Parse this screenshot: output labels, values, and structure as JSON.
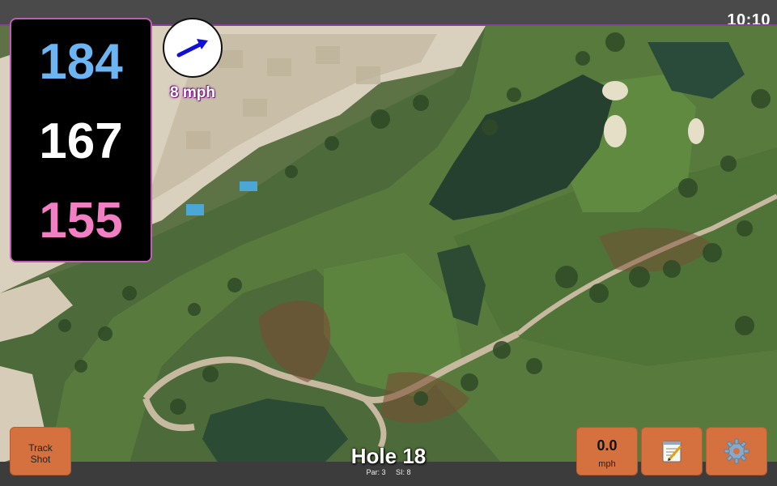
{
  "status": {
    "time": "10:10"
  },
  "distances": {
    "back": "184",
    "center": "167",
    "front": "155",
    "colors": {
      "back": "#6db4f2",
      "center": "#ffffff",
      "front": "#f27ec3"
    }
  },
  "wind": {
    "label": "8 mph",
    "icon": "wind-direction-arrow-icon"
  },
  "buttons": {
    "track_shot": "Track\nShot",
    "speed_value": "0.0",
    "speed_unit": "mph",
    "notes_icon": "notepad-icon",
    "settings_icon": "gear-icon"
  },
  "hole": {
    "title": "Hole 18",
    "par": "Par: 3",
    "si": "SI: 8"
  },
  "theme": {
    "button": "#d4713f",
    "accent": "#c15bb7"
  }
}
